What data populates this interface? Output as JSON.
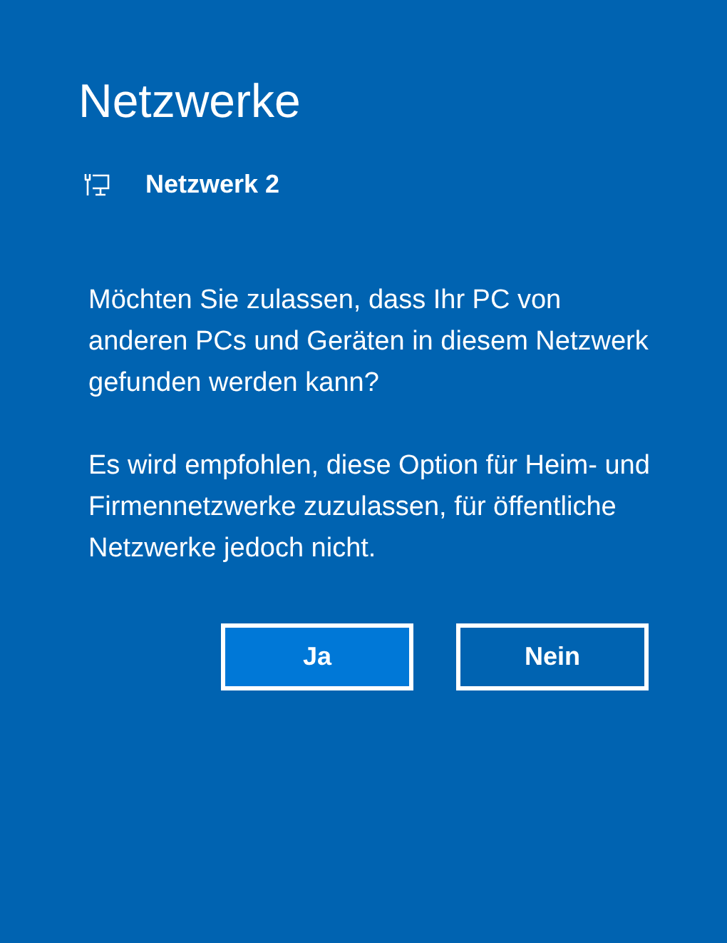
{
  "title": "Netzwerke",
  "network": {
    "name": "Netzwerk 2"
  },
  "paragraphs": [
    "Möchten Sie zulassen, dass Ihr PC von anderen PCs und Geräten in diesem Netzwerk gefunden werden kann?",
    "Es wird empfohlen, diese Option für Heim- und Firmennetzwerke zuzulassen, für öffentliche Netzwerke jedoch nicht."
  ],
  "buttons": [
    {
      "label": "Ja",
      "default": true
    },
    {
      "label": "Nein",
      "default": false
    }
  ]
}
